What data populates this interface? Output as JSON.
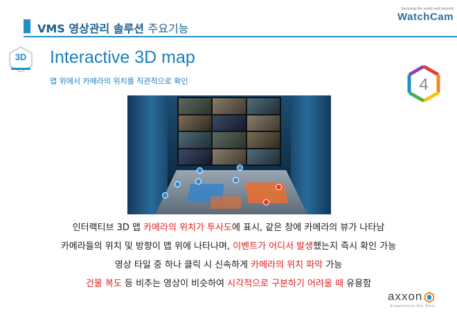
{
  "header": {
    "title": "VMS 영상관리 솔루션",
    "title_thin": "주요기능",
    "accent_color": "#1f8fc9"
  },
  "brand": {
    "tagline": "Securing the world and beyond",
    "name": "WatchCam"
  },
  "section": {
    "badge_label": "3D",
    "title": "Interactive 3D map",
    "subtitle": "맵 위에서 카메라의 위치를 직관적으로 확인",
    "number": "4"
  },
  "description": {
    "line1": {
      "a": "인터랙티브 3D 맵 ",
      "hl1": "카메라의 위치가 투사도",
      "b": "에 표시, 같은 창에 카메라의 뷰가 나타남"
    },
    "line2": {
      "a": "카메라들의 위치 및 방향이 맵 위에 나타나며, ",
      "hl1": "이벤트가 어디서 발생",
      "b": "했는지 즉시 확인 가능"
    },
    "line3": {
      "a": "영상 타일 중 하나 클릭 시 신속하게 ",
      "hl1": "카메라의 위치 파악",
      "b": " 가능"
    },
    "line4": {
      "hl1": "건물 복도",
      "a": " 등 비추는 영상이 비슷하여 ",
      "hl2": "시각적으로 구분하기 어려울 때",
      "b": " 유용함"
    },
    "highlight_color": "#e0201f"
  },
  "footer_logo": {
    "word": "axxon",
    "tagline": "Experience the Next"
  }
}
